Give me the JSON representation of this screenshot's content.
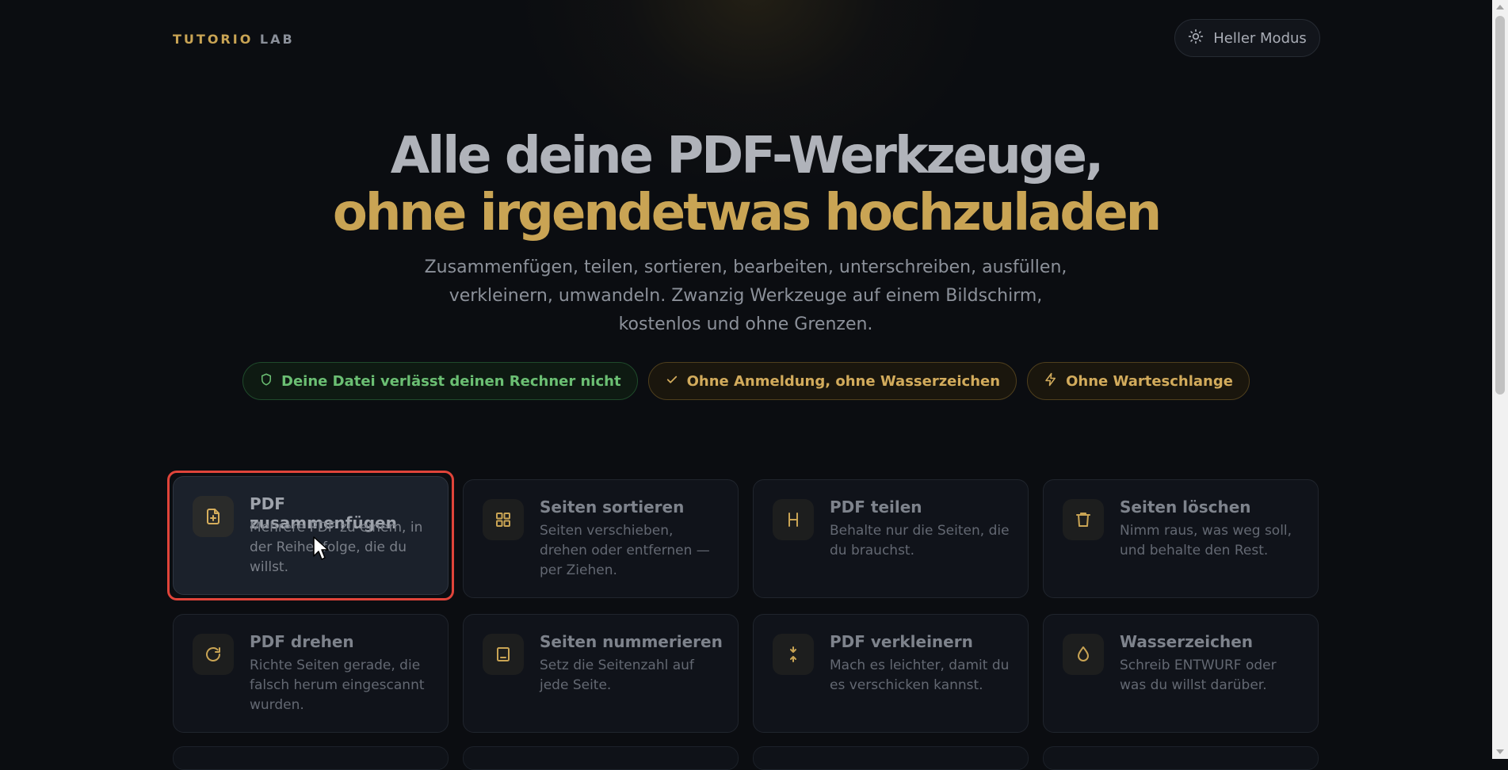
{
  "header": {
    "logo_part1": "TUTORIO",
    "logo_part2": "LAB",
    "mode_button_label": "Heller Modus",
    "mode_icon": "sun-icon"
  },
  "hero": {
    "title_line1": "Alle deine PDF-Werkzeuge,",
    "title_line2": "ohne irgendetwas hochzuladen",
    "subtitle": "Zusammenfügen, teilen, sortieren, bearbeiten, unterschreiben, ausfüllen, verkleinern, umwandeln. Zwanzig Werkzeuge auf einem Bildschirm, kostenlos und ohne Grenzen."
  },
  "badges": [
    {
      "label": "Deine Datei verlässt deinen Rechner nicht",
      "icon": "shield-icon",
      "color": "#6bbf73"
    },
    {
      "label": "Ohne Anmeldung, ohne Wasserzeichen",
      "icon": "check-icon",
      "color": "#d2ab5c"
    },
    {
      "label": "Ohne Warteschlange",
      "icon": "bolt-icon",
      "color": "#d2ab5c"
    }
  ],
  "tools": [
    {
      "title": "PDF zusammenfügen",
      "desc": "Mehrere PDF zu einem, in der Reihenfolge, die du willst.",
      "icon": "file-plus-icon",
      "highlighted": true
    },
    {
      "title": "Seiten sortieren",
      "desc": "Seiten verschieben, drehen oder entfernen — per Ziehen.",
      "icon": "grid-icon"
    },
    {
      "title": "PDF teilen",
      "desc": "Behalte nur die Seiten, die du brauchst.",
      "icon": "split-icon"
    },
    {
      "title": "Seiten löschen",
      "desc": "Nimm raus, was weg soll, und behalte den Rest.",
      "icon": "trash-icon"
    },
    {
      "title": "PDF drehen",
      "desc": "Richte Seiten gerade, die falsch herum eingescannt wurden.",
      "icon": "rotate-icon"
    },
    {
      "title": "Seiten nummerieren",
      "desc": "Setz die Seitenzahl auf jede Seite.",
      "icon": "page-number-icon"
    },
    {
      "title": "PDF verkleinern",
      "desc": "Mach es leichter, damit du es verschicken kannst.",
      "icon": "compress-icon"
    },
    {
      "title": "Wasserzeichen",
      "desc": "Schreib ENTWURF oder was du willst darüber.",
      "icon": "droplet-icon"
    }
  ],
  "colors": {
    "accent": "#c9a454",
    "background": "#0b0d11",
    "highlight_border": "#e0443a"
  }
}
